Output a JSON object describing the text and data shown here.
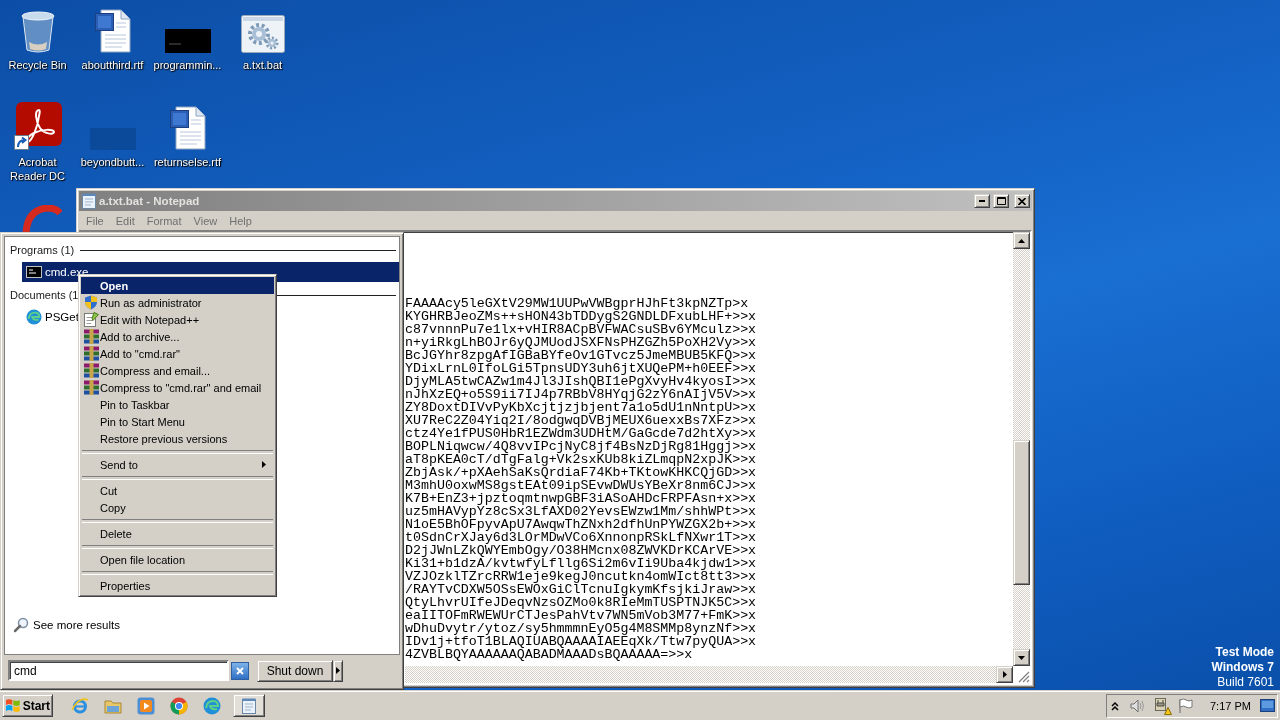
{
  "desktop_icons": [
    {
      "label": "Recycle Bin",
      "kind": "bin"
    },
    {
      "label": "aboutthird.rtf",
      "kind": "document"
    },
    {
      "label": "programmin...",
      "kind": "thumbnail"
    },
    {
      "label": "a.txt.bat",
      "kind": "script"
    },
    {
      "label": "Acrobat Reader DC",
      "kind": "pdf"
    },
    {
      "label": "beyondbutt...",
      "kind": "blank"
    },
    {
      "label": "returnselse.rtf",
      "kind": "document"
    }
  ],
  "notepad": {
    "title": "a.txt.bat - Notepad",
    "active": false,
    "menu": [
      "File",
      "Edit",
      "Format",
      "View",
      "Help"
    ],
    "lines": [
      "FAAAAcy5leGXtV29MW1UUPwVWBgprHJhFt3kpNZTp>x",
      "KYGHRBJeoZMs++sHON43bTDDygS2GNDLDFxubLHF+>>x",
      "c87vnnnPu7e1lx+vHIR8ACpBVFWACsuSBv6YMculz>>x",
      "n+yiRkgLhBOJr6yQJMUodJSXFNsPHZGZh5PoXH2Vy>>x",
      "BcJGYhr8zpgAfIGBaBYfeOv1GTvcz5JmeMBUB5KFQ>>x",
      "YDixLrnL0IfoLGi5TpnsUDY3uh6jtXUQePM+h0EEF>>x",
      "DjyMLA5twCAZw1m4Jl3JIshQBI1ePgXvyHv4kyosI>>x",
      "nJhXzEQ+o5S9ii7IJ4p7RBbV8HYqjG2zY6nAIjV5V>>x",
      "ZY8DoxtDIVvPyKbXcjtjzjbjent7a1o5dU1nNntpU>>x",
      "XU7ReC2Z04Yiq2I/8odgwqDVBjMEUX6uexxBs7XFz>>x",
      "ctz4Ye1fPUS0HbR1EZWdm3UDHtM/GaGcde7d2htXy>>x",
      "BOPLNiqwcw/4Q8vvIPcjNyC8jf4BsNzDjRg81Hggj>>x",
      "aT8pKEA0cT/dTgFalg+Vk2sxKUb8kiZLmqpN2xpJK>>x",
      "ZbjAsk/+pXAehSaKsQrdiaF74Kb+TKtowKHKCQjGD>>x",
      "M3mhU0oxwMS8gstEAt09ipSEvwDWUsYBeXr8nm6CJ>>x",
      "K7B+EnZ3+jpztoqmtnwpGBF3iASoAHDcFRPFAsn+x>>x",
      "uz5mHAVypYz8cSx3LfAXD02YevsEWzw1Mm/shhWPt>>x",
      "N1oE5BhOFpyvApU7AwqwThZNxh2dfhUnPYWZGX2b+>>x",
      "t0SdnCrXJay6d3LOrMDwVCo6XnnonpRSkLfNXwr1T>>x",
      "D2jJWnLZkQWYEmbOgy/O38HMcnx08ZWVKDrKCArVE>>x",
      "Ki31+b1dzA/kvtwfyLfllg6Si2m6vIi9Uba4kjdw1>>x",
      "VZJOzklTZrcRRW1eje9kegJ0ncutkn4omWIct8tt3>>x",
      "/RAYTvCDXW5OSsEWOxGiClTcnuIgkymKfsjkiJraw>>x",
      "QtyLhvrUIfeJDeqvNzsOZMo0k8RIeMmTUSPTNJK5C>>x",
      "eaIITOFmRWEWUrCTJesPahVtv7WN5mVob3M77+FmK>>x",
      "wDhuDvytr/ytoz/sy5hmmmnEyO5g4M8SMMp8ynzNf>>x",
      "IDv1j+tfoT1BLAQIUABQAAAAIAEEqXk/Ttw7pyQUA>>x",
      "4ZVBLBQYAAAAAAQABADMAAADsBQAAAAA=>>x"
    ]
  },
  "start_menu": {
    "sections": [
      {
        "heading": "Programs (1)",
        "items": [
          {
            "label": "cmd.exe",
            "kind": "console",
            "selected": true
          }
        ]
      },
      {
        "heading": "Documents (1",
        "items": [
          {
            "label": "PSGet",
            "kind": "browser",
            "selected": false
          }
        ]
      }
    ],
    "more_results": "See more results",
    "search": {
      "value": "cmd"
    },
    "shutdown": "Shut down"
  },
  "context_menu": {
    "groups": [
      [
        {
          "label": "Open",
          "kind": "default",
          "selected": true
        },
        {
          "label": "Run as administrator",
          "kind": "admin",
          "selected": false
        },
        {
          "label": "Edit with Notepad++",
          "kind": "editor",
          "selected": false
        },
        {
          "label": "Add to archive...",
          "kind": "archive",
          "selected": false
        },
        {
          "label": "Add to \"cmd.rar\"",
          "kind": "archive",
          "selected": false
        },
        {
          "label": "Compress and email...",
          "kind": "archive",
          "selected": false
        },
        {
          "label": "Compress to \"cmd.rar\" and email",
          "kind": "archive",
          "selected": false
        },
        {
          "label": "Pin to Taskbar",
          "kind": "plain",
          "selected": false
        },
        {
          "label": "Pin to Start Menu",
          "kind": "plain",
          "selected": false
        },
        {
          "label": "Restore previous versions",
          "kind": "plain",
          "selected": false
        }
      ],
      [
        {
          "label": "Send to",
          "kind": "submenu",
          "selected": false
        }
      ],
      [
        {
          "label": "Cut",
          "kind": "plain",
          "selected": false
        },
        {
          "label": "Copy",
          "kind": "plain",
          "selected": false
        }
      ],
      [
        {
          "label": "Delete",
          "kind": "plain",
          "selected": false
        }
      ],
      [
        {
          "label": "Open file location",
          "kind": "plain",
          "selected": false
        }
      ],
      [
        {
          "label": "Properties",
          "kind": "plain",
          "selected": false
        }
      ]
    ]
  },
  "desktop_notice": {
    "mode": "Test Mode",
    "edition": "Windows 7",
    "build": "Build 7601"
  },
  "taskbar": {
    "start": "Start",
    "launchers": [
      {
        "kind": "ie"
      },
      {
        "kind": "explorer"
      },
      {
        "kind": "player"
      },
      {
        "kind": "chrome"
      },
      {
        "kind": "edge"
      }
    ],
    "task_buttons": [
      {
        "kind": "notepad"
      }
    ],
    "clock": "7:17 PM"
  }
}
